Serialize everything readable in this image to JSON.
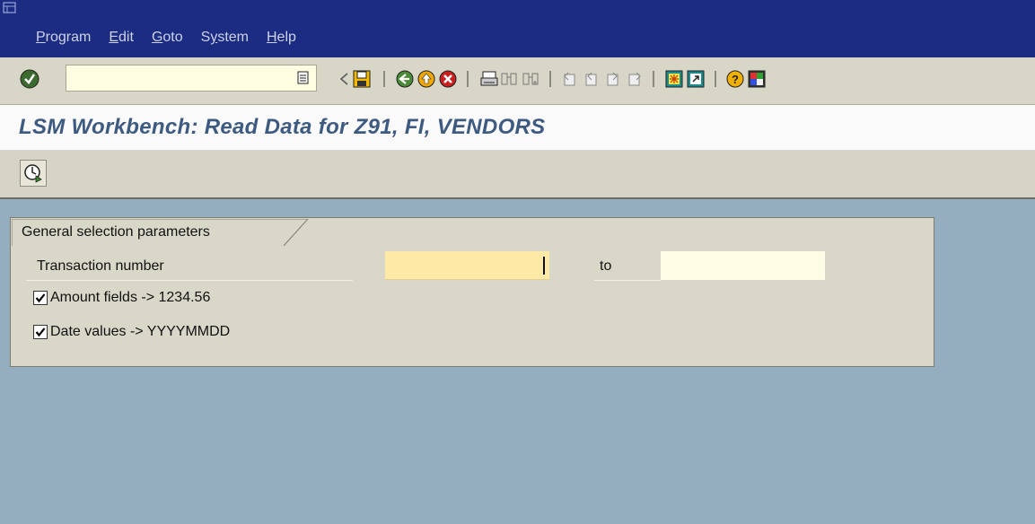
{
  "menu": {
    "items": [
      {
        "label": "Program",
        "mnemonic": "P",
        "rest": "rogram"
      },
      {
        "label": "Edit",
        "mnemonic": "E",
        "rest": "dit"
      },
      {
        "label": "Goto",
        "mnemonic": "G",
        "rest": "oto"
      },
      {
        "label": "System",
        "mnemonic": "S",
        "pre": "S",
        "mid": "y",
        "rest": "stem"
      },
      {
        "label": "Help",
        "mnemonic": "H",
        "rest": "elp"
      }
    ]
  },
  "toolbar": {
    "command_field_value": "",
    "icons": [
      "enter-icon",
      "history-icon",
      "back-arrow-icon",
      "save-icon",
      "back-icon",
      "exit-icon",
      "cancel-icon",
      "print-icon",
      "find-icon",
      "find-next-icon",
      "first-page-icon",
      "prev-page-icon",
      "next-page-icon",
      "last-page-icon",
      "new-session-icon",
      "shortcut-icon",
      "help-icon",
      "layout-icon"
    ]
  },
  "page": {
    "title": "LSM Workbench: Read Data for Z91, FI, VENDORS"
  },
  "app_toolbar": {
    "execute_icon": "execute-clock-icon"
  },
  "selection": {
    "group_title": "General selection parameters",
    "transaction_label": "Transaction number",
    "transaction_from": "",
    "to_label": "to",
    "transaction_to": "",
    "amount_label": "Amount fields -> 1234.56",
    "amount_checked": true,
    "date_label": "Date values -> YYYYMMDD",
    "date_checked": true
  },
  "colors": {
    "menubar": "#1b2c82",
    "title": "#3d5a80",
    "background": "#94aebf",
    "required_field": "#ffe9a6"
  }
}
